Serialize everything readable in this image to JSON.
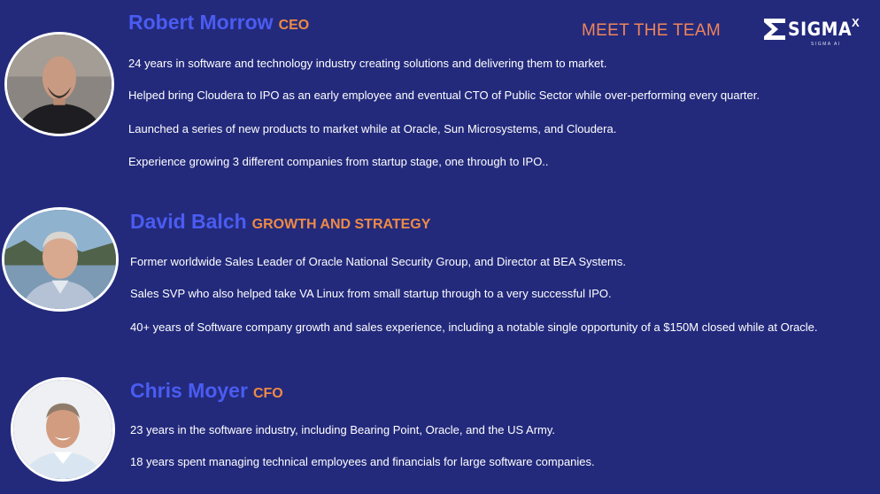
{
  "header": {
    "title": "MEET THE TEAM",
    "logo": {
      "word": "SIGMA",
      "superscript": "X",
      "tagline": "SIGMA AI"
    }
  },
  "team": [
    {
      "name": "Robert Morrow",
      "role": "CEO",
      "bullets": [
        "24 years in software and technology industry creating solutions and delivering them to market.",
        "Helped bring Cloudera to IPO as an early employee and eventual CTO of Public Sector while over-performing every quarter.",
        "Launched a series of new products to market while at Oracle, Sun Microsystems, and Cloudera.",
        "Experience growing 3 different companies from startup stage, one through to IPO.."
      ]
    },
    {
      "name": "David Balch",
      "role": "GROWTH AND STRATEGY",
      "bullets": [
        "Former worldwide Sales Leader of Oracle National Security Group, and Director at BEA Systems.",
        "Sales SVP who also helped take VA Linux from small startup through to a very successful IPO.",
        "40+ years of Software company growth and sales experience, including a notable single opportunity of a $150M closed while at Oracle."
      ]
    },
    {
      "name": "Chris Moyer",
      "role": "CFO",
      "bullets": [
        "23 years in the software industry, including Bearing Point, Oracle, and the US Army.",
        "18 years spent managing technical employees and financials for large software companies."
      ]
    }
  ],
  "colors": {
    "background": "#232a7c",
    "name": "#4a5cf2",
    "role": "#ee8a45",
    "heading": "#f0845a",
    "text": "#ffffff"
  }
}
